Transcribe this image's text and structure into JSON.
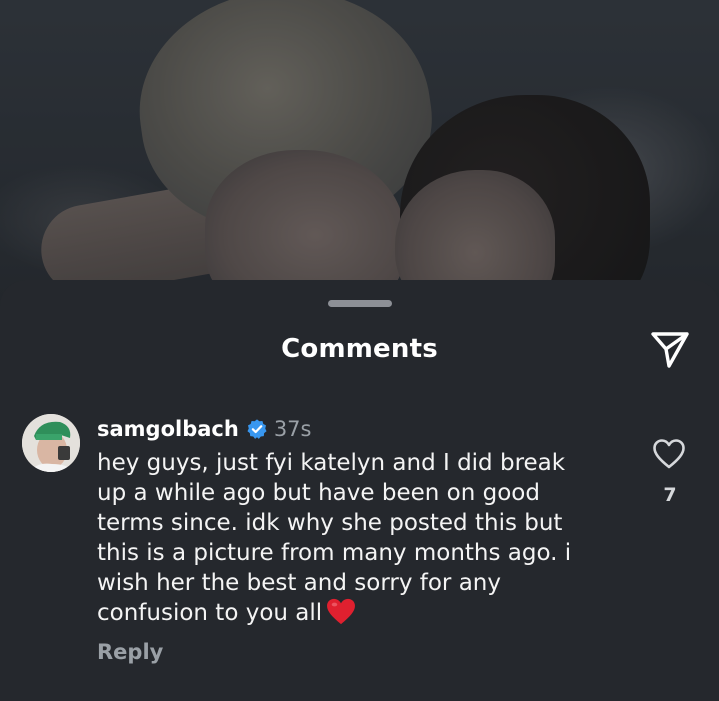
{
  "sheet": {
    "title": "Comments",
    "share_icon": "send-icon"
  },
  "comment": {
    "username": "samgolbach",
    "verified_icon": "verified-badge-icon",
    "timestamp": "37s",
    "text": "hey guys, just fyi katelyn and I did break\nup a while ago but have been on good\nterms since. idk why she posted this but\nthis is a picture from many months ago. i\nwish her the best and sorry for any\nconfusion to you all",
    "emoji": "red-heart-emoji",
    "reply_label": "Reply",
    "like_icon": "heart-outline-icon",
    "like_count": "7"
  },
  "colors": {
    "sheet_bg": "#25282d",
    "verified_blue": "#3897f0",
    "emoji_red": "#e0202f",
    "muted_text": "#9aa0a6"
  }
}
